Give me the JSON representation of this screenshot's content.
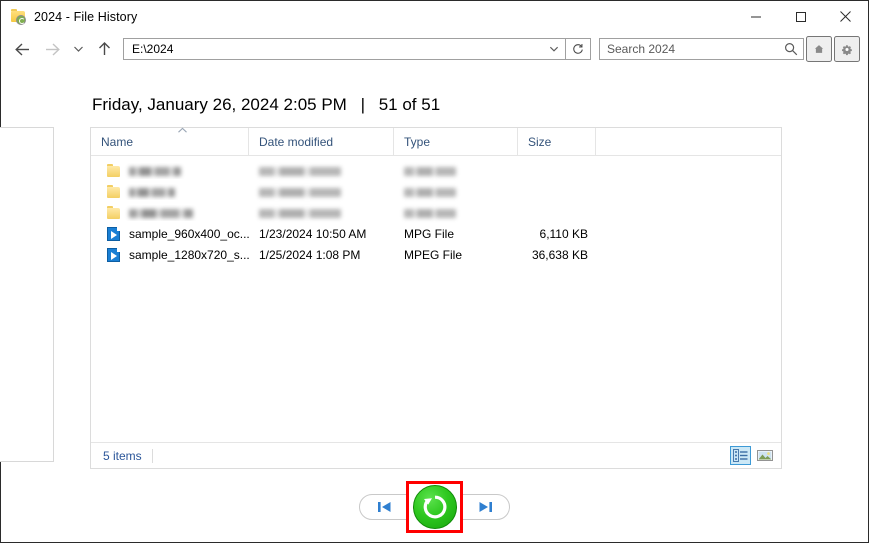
{
  "window": {
    "title": "2024 - File History",
    "icon": "file-history-folder-icon",
    "controls": {
      "minimize_label": "Minimize",
      "maximize_label": "Maximize",
      "close_label": "Close"
    }
  },
  "navbar": {
    "back_label": "Back",
    "forward_label": "Forward",
    "recent_label": "Recent locations",
    "up_label": "Up",
    "address_value": "E:\\2024",
    "address_dropdown_label": "Previous locations",
    "refresh_label": "Refresh",
    "home_label": "Home",
    "settings_label": "Settings"
  },
  "search": {
    "value": "",
    "placeholder": "Search 2024"
  },
  "heading": {
    "timestamp": "Friday, January 26, 2024 2:05 PM",
    "separator": "|",
    "counter": "51 of 51"
  },
  "columns": [
    {
      "label": "Name"
    },
    {
      "label": "Date modified"
    },
    {
      "label": "Type"
    },
    {
      "label": "Size"
    }
  ],
  "sort": {
    "column": "Name",
    "direction": "ascending",
    "indicator": "chevron-up-icon"
  },
  "rows": [
    {
      "icon": "folder-icon",
      "name": "",
      "date": "",
      "type": "",
      "size": "",
      "redacted": true,
      "name_width": 52,
      "date_width": 82,
      "type_width": 52
    },
    {
      "icon": "folder-icon",
      "name": "",
      "date": "",
      "type": "",
      "size": "",
      "redacted": true,
      "name_width": 46,
      "date_width": 82,
      "type_width": 52
    },
    {
      "icon": "folder-icon",
      "name": "",
      "date": "",
      "type": "",
      "size": "",
      "redacted": true,
      "name_width": 64,
      "date_width": 82,
      "type_width": 52
    },
    {
      "icon": "media-file-icon",
      "name": "sample_960x400_oc...",
      "date": "1/23/2024 10:50 AM",
      "type": "MPG File",
      "size": "6,110 KB",
      "redacted": false
    },
    {
      "icon": "media-file-icon",
      "name": "sample_1280x720_s...",
      "date": "1/25/2024 1:08 PM",
      "type": "MPEG File",
      "size": "36,638 KB",
      "redacted": false
    }
  ],
  "status": {
    "item_count": "5 items"
  },
  "view_buttons": {
    "details_label": "Details view",
    "details_selected": true,
    "large_icons_label": "Large icons view",
    "large_icons_selected": false
  },
  "transport": {
    "previous_label": "Previous version",
    "restore_label": "Restore to original location",
    "next_label": "Next version",
    "highlight_color": "#ff0000",
    "restore_color": "#2ec81f"
  },
  "colors": {
    "accent_blue": "#3d9ad6",
    "column_header_text": "#34537a",
    "status_text": "#2a5599",
    "nav_icon": "#5a5a5a"
  }
}
